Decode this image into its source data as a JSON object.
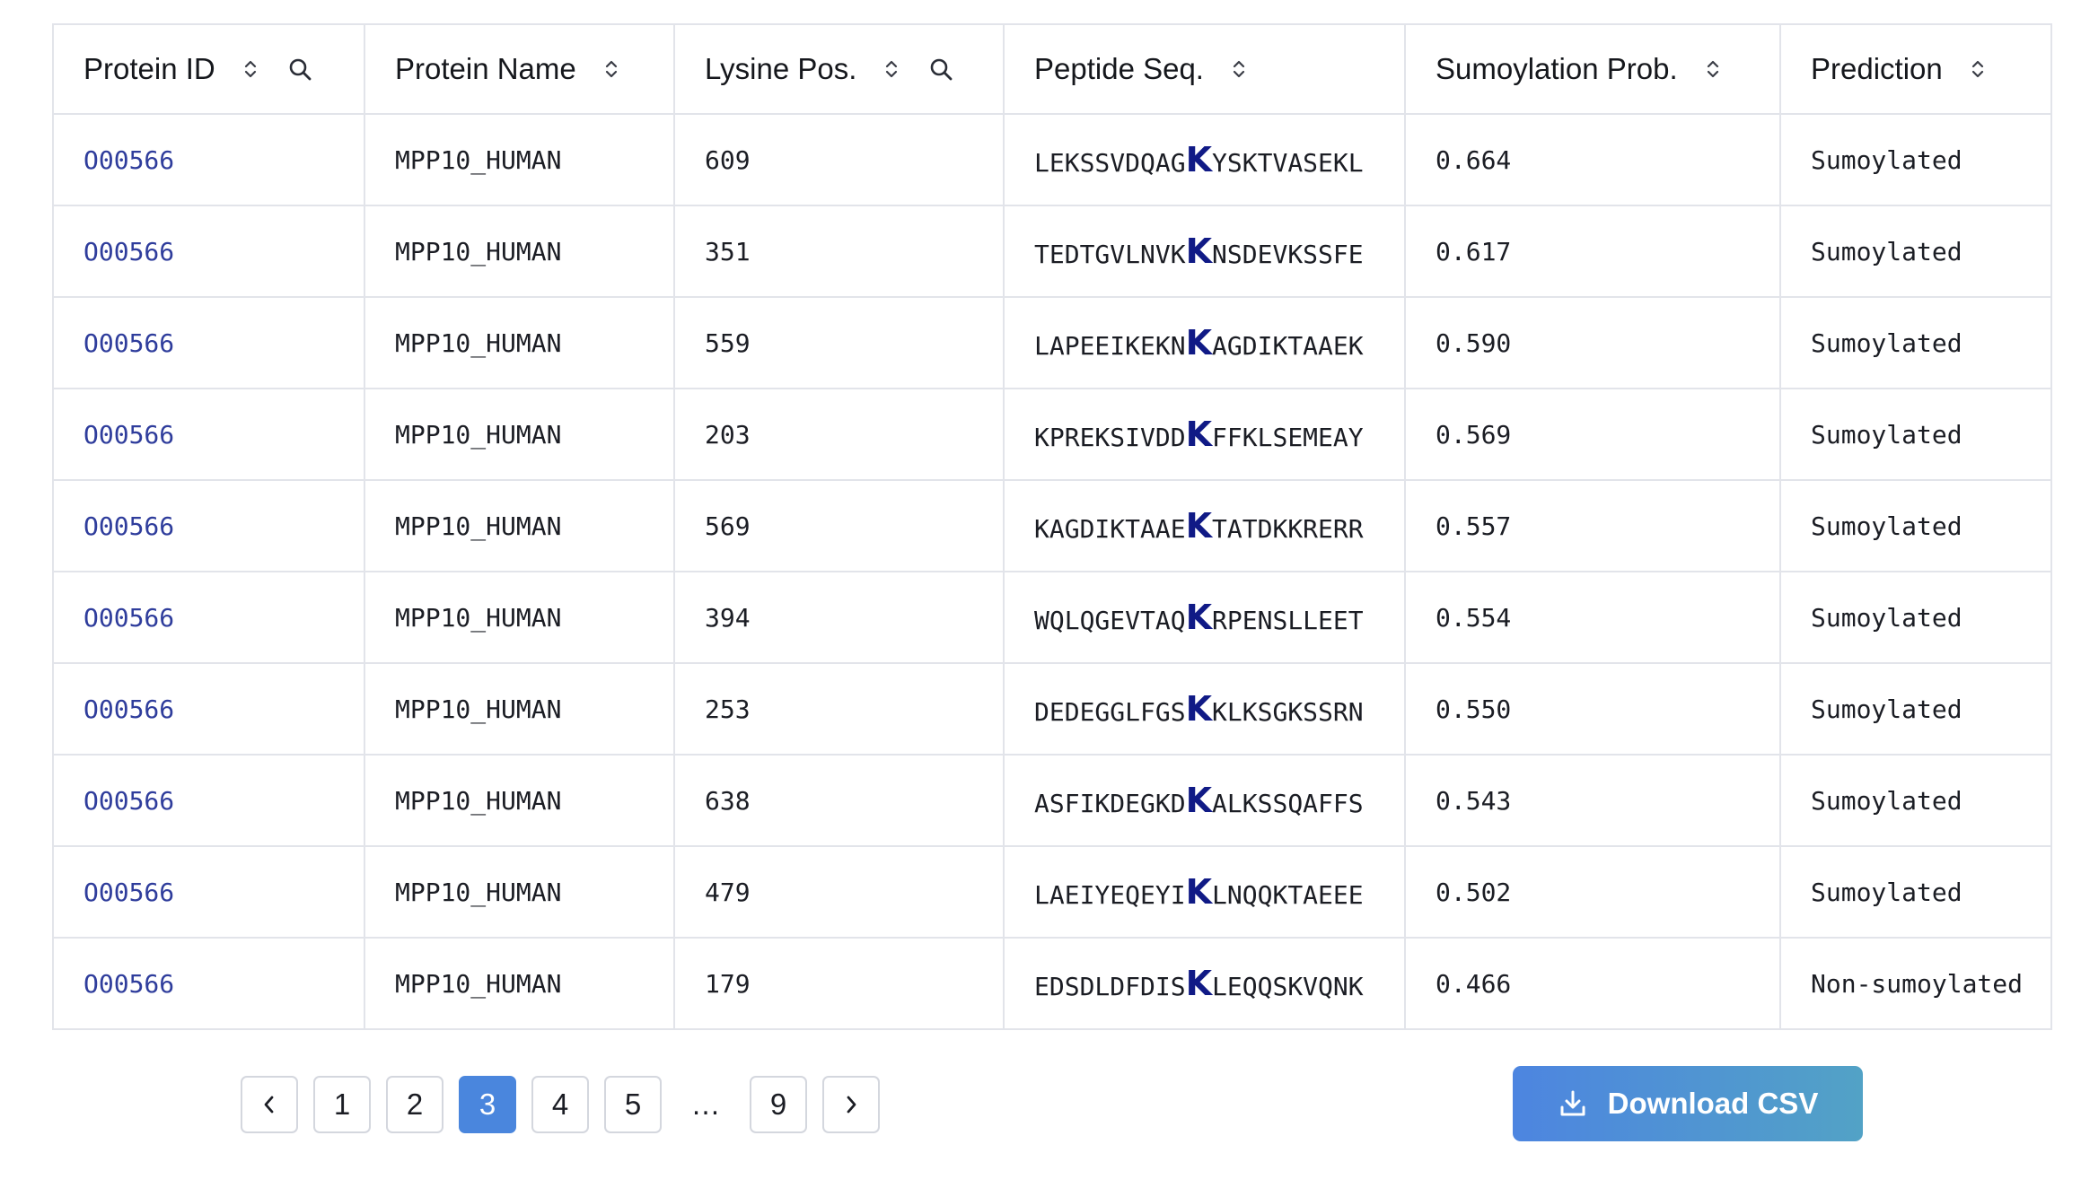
{
  "table": {
    "columns": [
      {
        "label": "Protein ID",
        "searchable": true
      },
      {
        "label": "Protein Name",
        "searchable": false
      },
      {
        "label": "Lysine Pos.",
        "searchable": true
      },
      {
        "label": "Peptide Seq.",
        "searchable": false
      },
      {
        "label": "Sumoylation Prob.",
        "searchable": false
      },
      {
        "label": "Prediction",
        "searchable": false
      }
    ],
    "rows": [
      {
        "protein_id": "O00566",
        "protein_name": "MPP10_HUMAN",
        "lysine_pos": "609",
        "pep_pre": "LEKSSVDQAG",
        "pep_k": "K",
        "pep_post": "YSKTVASEKL",
        "prob": "0.664",
        "prediction": "Sumoylated"
      },
      {
        "protein_id": "O00566",
        "protein_name": "MPP10_HUMAN",
        "lysine_pos": "351",
        "pep_pre": "TEDTGVLNVK",
        "pep_k": "K",
        "pep_post": "NSDEVKSSFE",
        "prob": "0.617",
        "prediction": "Sumoylated"
      },
      {
        "protein_id": "O00566",
        "protein_name": "MPP10_HUMAN",
        "lysine_pos": "559",
        "pep_pre": "LAPEEIKEKN",
        "pep_k": "K",
        "pep_post": "AGDIKTAAEK",
        "prob": "0.590",
        "prediction": "Sumoylated"
      },
      {
        "protein_id": "O00566",
        "protein_name": "MPP10_HUMAN",
        "lysine_pos": "203",
        "pep_pre": "KPREKSIVDD",
        "pep_k": "K",
        "pep_post": "FFKLSEMEAY",
        "prob": "0.569",
        "prediction": "Sumoylated"
      },
      {
        "protein_id": "O00566",
        "protein_name": "MPP10_HUMAN",
        "lysine_pos": "569",
        "pep_pre": "KAGDIKTAAE",
        "pep_k": "K",
        "pep_post": "TATDKKRERR",
        "prob": "0.557",
        "prediction": "Sumoylated"
      },
      {
        "protein_id": "O00566",
        "protein_name": "MPP10_HUMAN",
        "lysine_pos": "394",
        "pep_pre": "WQLQGEVTAQ",
        "pep_k": "K",
        "pep_post": "RPENSLLEET",
        "prob": "0.554",
        "prediction": "Sumoylated"
      },
      {
        "protein_id": "O00566",
        "protein_name": "MPP10_HUMAN",
        "lysine_pos": "253",
        "pep_pre": "DEDEGGLFGS",
        "pep_k": "K",
        "pep_post": "KLKSGKSSRN",
        "prob": "0.550",
        "prediction": "Sumoylated"
      },
      {
        "protein_id": "O00566",
        "protein_name": "MPP10_HUMAN",
        "lysine_pos": "638",
        "pep_pre": "ASFIKDEGKD",
        "pep_k": "K",
        "pep_post": "ALKSSQAFFS",
        "prob": "0.543",
        "prediction": "Sumoylated"
      },
      {
        "protein_id": "O00566",
        "protein_name": "MPP10_HUMAN",
        "lysine_pos": "479",
        "pep_pre": "LAEIYEQEYI",
        "pep_k": "K",
        "pep_post": "LNQQKTAEEE",
        "prob": "0.502",
        "prediction": "Sumoylated"
      },
      {
        "protein_id": "O00566",
        "protein_name": "MPP10_HUMAN",
        "lysine_pos": "179",
        "pep_pre": "EDSDLDFDIS",
        "pep_k": "K",
        "pep_post": "LEQQSKVQNK",
        "prob": "0.466",
        "prediction": "Non-sumoylated"
      }
    ]
  },
  "pagination": {
    "prev_icon": "chevron-left-icon",
    "next_icon": "chevron-right-icon",
    "pages": [
      "1",
      "2",
      "3",
      "4",
      "5",
      "…",
      "9"
    ],
    "current": "3"
  },
  "download": {
    "label": "Download CSV",
    "icon": "download-icon"
  },
  "colors": {
    "link": "#2f3d9c",
    "highlight_k": "#101a86",
    "active_page": "#4a86dd",
    "button_gradient_start": "#4d85e0",
    "button_gradient_end": "#52a2c6",
    "border": "#e2e4ea"
  }
}
